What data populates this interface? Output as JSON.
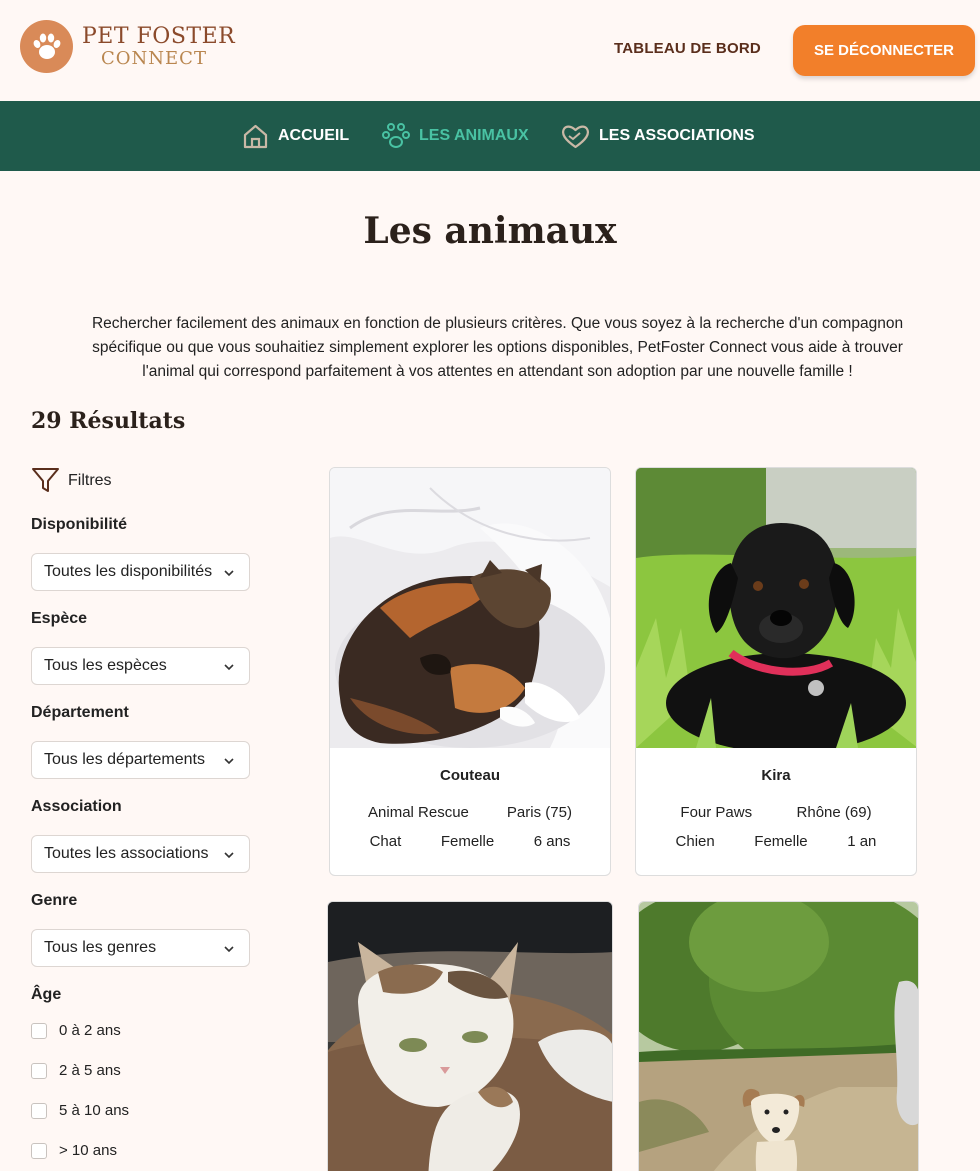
{
  "header": {
    "logo_line1": "PET FOSTER",
    "logo_line2": "CONNECT",
    "dashboard_link": "TABLEAU DE BORD",
    "logout_button": "SE DÉCONNECTER"
  },
  "nav": {
    "items": [
      {
        "label": "ACCUEIL",
        "icon": "home-icon",
        "active": false
      },
      {
        "label": "LES ANIMAUX",
        "icon": "paw-icon",
        "active": true
      },
      {
        "label": "LES ASSOCIATIONS",
        "icon": "heart-hands-icon",
        "active": false
      }
    ]
  },
  "page": {
    "title": "Les animaux",
    "intro": "Rechercher facilement des animaux en fonction de plusieurs critères. Que vous soyez à la recherche d'un compagnon spécifique ou que vous souhaitiez simplement explorer les options disponibles, PetFoster Connect vous aide à trouver l'animal qui correspond parfaitement à vos attentes en attendant son adoption par une nouvelle famille !",
    "results": "29 Résultats"
  },
  "filters": {
    "heading": "Filtres",
    "availability": {
      "label": "Disponibilité",
      "value": "Toutes les disponibilités"
    },
    "species": {
      "label": "Espèce",
      "value": "Tous les espèces"
    },
    "department": {
      "label": "Département",
      "value": "Tous les départements"
    },
    "association": {
      "label": "Association",
      "value": "Toutes les associations"
    },
    "gender": {
      "label": "Genre",
      "value": "Tous les genres"
    },
    "age": {
      "label": "Âge",
      "options": [
        "0 à 2 ans",
        "2 à 5 ans",
        "5 à 10 ans",
        "> 10 ans"
      ]
    }
  },
  "animals": [
    {
      "name": "Couteau",
      "association": "Animal Rescue",
      "location": "Paris (75)",
      "species": "Chat",
      "gender": "Femelle",
      "age": "6 ans"
    },
    {
      "name": "Kira",
      "association": "Four Paws",
      "location": "Rhône (69)",
      "species": "Chien",
      "gender": "Femelle",
      "age": "1 an"
    },
    {
      "name": "",
      "association": "",
      "location": "",
      "species": "",
      "gender": "",
      "age": ""
    },
    {
      "name": "",
      "association": "",
      "location": "",
      "species": "",
      "gender": "",
      "age": ""
    }
  ],
  "colors": {
    "background": "#fff8f5",
    "nav": "#1f5a4b",
    "nav_active": "#49c2a3",
    "accent": "#f27f2a",
    "brand_brown": "#8b4a2b"
  }
}
